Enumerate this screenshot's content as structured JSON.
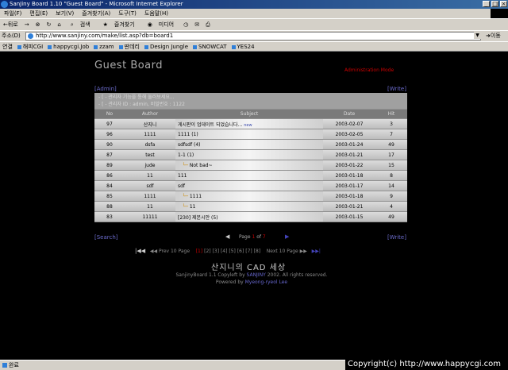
{
  "window": {
    "title": "SanJiny Board 1.10 \"Guest Board\" - Microsoft Internet Explorer"
  },
  "menu": [
    "파일(F)",
    "편집(E)",
    "보기(V)",
    "즐겨찾기(A)",
    "도구(T)",
    "도움말(H)"
  ],
  "toolbar": {
    "back": "←뒤로",
    "forward": "→",
    "search": "검색",
    "favorites": "즐겨찾기",
    "media": "미디어"
  },
  "address": {
    "label": "주소(D)",
    "url": "http://www.sanjiny.com/make/list.asp?db=board1",
    "go": "이동"
  },
  "links": {
    "label": "연결",
    "items": [
      "해피CGI",
      "happycgi.Job",
      "zzam",
      "딴데리",
      "Design Jungle",
      "SNOWCAT",
      "YES24"
    ]
  },
  "board": {
    "title": "Guest Board",
    "admin_mode": "Administration Mode",
    "admin_link": "[Admin]",
    "write_link": "[Write]",
    "search_link": "[Search]",
    "notice": [
      "- [ - 관리자 기능을 통해 둘러보세요...",
      "- [ - 관리자 ID : admin, 비밀번호 : 1122"
    ],
    "columns": [
      "No",
      "Author",
      "Subject",
      "Date",
      "Hit"
    ],
    "rows": [
      {
        "no": "97",
        "author": "산지니",
        "subject": "게시판이 업데이트 되었습니다...",
        "count": "",
        "tag": "new",
        "reply": false,
        "date": "2003-02-07",
        "hit": "3"
      },
      {
        "no": "96",
        "author": "1111",
        "subject": "1111",
        "count": "(1)",
        "tag": "",
        "reply": false,
        "date": "2003-02-05",
        "hit": "7"
      },
      {
        "no": "90",
        "author": "dsfa",
        "subject": "sdfsdf",
        "count": "(4)",
        "tag": "",
        "reply": false,
        "date": "2003-01-24",
        "hit": "49"
      },
      {
        "no": "87",
        "author": "test",
        "subject": "1-1",
        "count": "(1)",
        "tag": "",
        "reply": false,
        "date": "2003-01-21",
        "hit": "17"
      },
      {
        "no": "89",
        "author": "jude",
        "subject": "Not bad~",
        "count": "",
        "tag": "",
        "reply": true,
        "date": "2003-01-22",
        "hit": "15"
      },
      {
        "no": "86",
        "author": "11",
        "subject": "111",
        "count": "",
        "tag": "",
        "reply": false,
        "date": "2003-01-18",
        "hit": "8"
      },
      {
        "no": "84",
        "author": "sdf",
        "subject": "sdf",
        "count": "",
        "tag": "",
        "reply": false,
        "date": "2003-01-17",
        "hit": "14"
      },
      {
        "no": "85",
        "author": "1111",
        "subject": "1111",
        "count": "",
        "tag": "",
        "reply": true,
        "date": "2003-01-18",
        "hit": "9"
      },
      {
        "no": "88",
        "author": "11",
        "subject": "11",
        "count": "",
        "tag": "",
        "reply": true,
        "date": "2003-01-21",
        "hit": "4"
      },
      {
        "no": "83",
        "author": "11111",
        "subject": "[230] 제본시안",
        "count": "(5)",
        "tag": "",
        "reply": false,
        "date": "2003-01-15",
        "hit": "49"
      }
    ],
    "pager": {
      "prefix": "Page",
      "current": "1",
      "of": "of",
      "total": "7"
    },
    "nav10": {
      "first": "|◀◀",
      "prev": "◀◀ Prev 10 Page",
      "pages": [
        "[1]",
        "[2]",
        "[3]",
        "[4]",
        "[5]",
        "[6]",
        "[7]",
        "[8]"
      ],
      "next": "Next 10 Page ▶▶",
      "last": "▶▶|"
    },
    "site_title": "산지니의 CAD 세상",
    "copyright_a": "SanjinyBoard 1.1 Copyleft by",
    "copyright_name": "SANJINY",
    "copyright_b": "2002. All rights reserved.",
    "powered_a": "Powered by",
    "powered_name": "Myeong-ryeol Lee"
  },
  "status": {
    "text": "완료"
  },
  "watermark": "Copyright(c) http://www.happycgi.com"
}
